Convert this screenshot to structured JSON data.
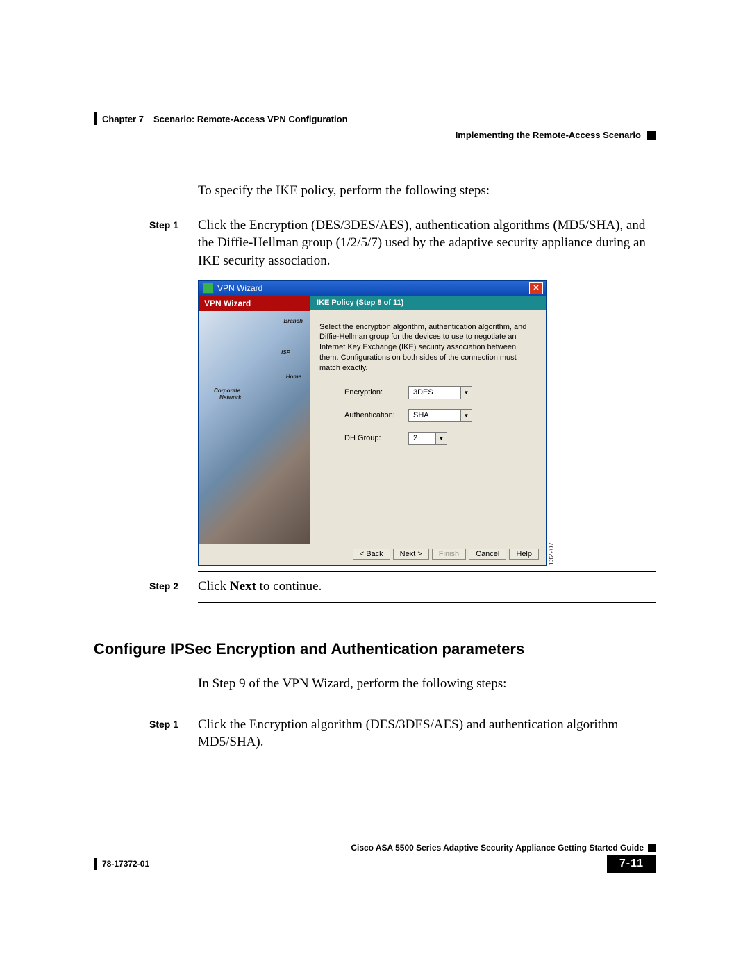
{
  "header": {
    "chapter": "Chapter 7",
    "chapter_title": "Scenario: Remote-Access VPN Configuration",
    "section": "Implementing the Remote-Access Scenario"
  },
  "intro_text": "To specify the IKE policy, perform the following steps:",
  "steps_a": [
    {
      "label": "Step 1",
      "text": "Click the Encryption (DES/3DES/AES), authentication algorithms (MD5/SHA), and the Diffie-Hellman group (1/2/5/7) used by the adaptive security appliance during an IKE security association."
    },
    {
      "label": "Step 2",
      "text_prefix": "Click ",
      "bold": "Next",
      "text_suffix": " to continue."
    }
  ],
  "figure": {
    "window_title": "VPN Wizard",
    "sidebar_title": "VPN Wizard",
    "sidebar_tags": {
      "branch": "Branch",
      "isp": "ISP",
      "home": "Home",
      "corp1": "Corporate",
      "corp2": "Network"
    },
    "step_banner": "IKE Policy  (Step 8 of 11)",
    "description": "Select the encryption algorithm, authentication algorithm, and Diffie-Hellman group for the devices to use to negotiate an Internet Key Exchange (IKE) security association between them. Configurations on both sides of the connection must match exactly.",
    "fields": {
      "encryption": {
        "label": "Encryption:",
        "value": "3DES"
      },
      "authentication": {
        "label": "Authentication:",
        "value": "SHA"
      },
      "dh_group": {
        "label": "DH Group:",
        "value": "2"
      }
    },
    "buttons": {
      "back": "< Back",
      "next": "Next >",
      "finish": "Finish",
      "cancel": "Cancel",
      "help": "Help"
    },
    "figure_id": "132207"
  },
  "section_heading": "Configure IPSec Encryption and Authentication parameters",
  "section_intro": "In Step 9 of the VPN Wizard, perform the following steps:",
  "steps_b": [
    {
      "label": "Step 1",
      "text": "Click the Encryption algorithm (DES/3DES/AES) and authentication algorithm MD5/SHA)."
    }
  ],
  "footer": {
    "book_title": "Cisco ASA 5500 Series Adaptive Security Appliance Getting Started Guide",
    "doc_number": "78-17372-01",
    "page_number": "7-11"
  }
}
